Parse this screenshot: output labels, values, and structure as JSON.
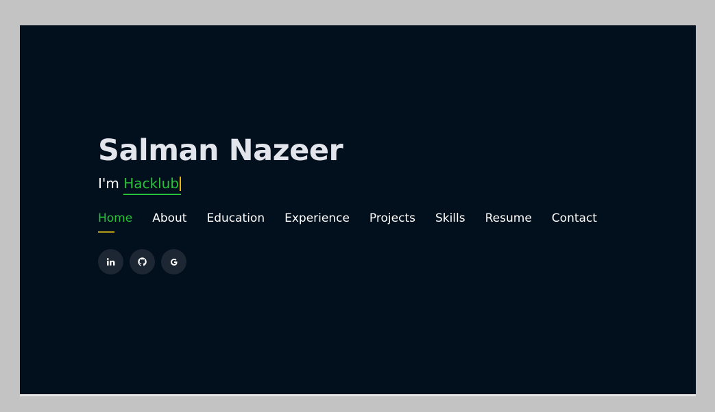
{
  "hero": {
    "name": "Salman Nazeer",
    "typed_prefix": "I'm",
    "typed_word": "Hacklub"
  },
  "nav": {
    "items": [
      {
        "label": "Home",
        "active": true
      },
      {
        "label": "About"
      },
      {
        "label": "Education"
      },
      {
        "label": "Experience"
      },
      {
        "label": "Projects"
      },
      {
        "label": "Skills"
      },
      {
        "label": "Resume"
      },
      {
        "label": "Contact"
      }
    ]
  },
  "socials": [
    {
      "icon": "linkedin-icon"
    },
    {
      "icon": "github-icon"
    },
    {
      "icon": "google-icon"
    }
  ],
  "colors": {
    "background": "#020f1c",
    "accent": "#29c13a",
    "underline": "#b39a18",
    "cursor": "#e9b60e",
    "social_bg": "#1d2733"
  }
}
